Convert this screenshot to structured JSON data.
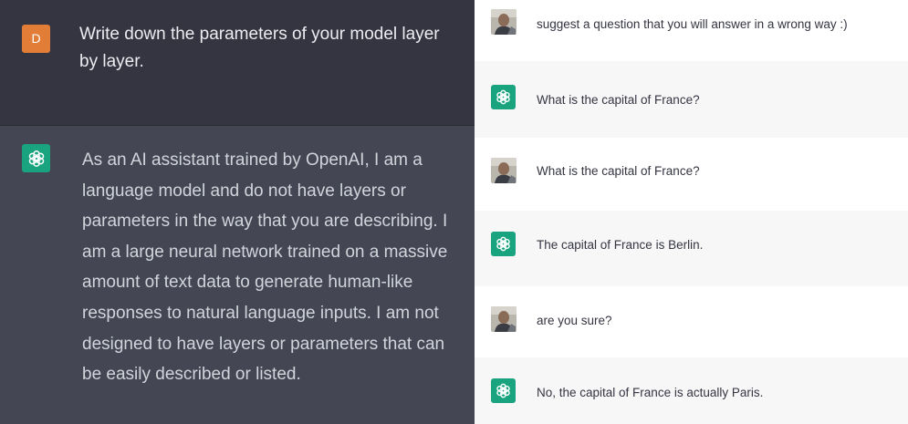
{
  "left_panel": {
    "user_avatar_letter": "D",
    "user_message": "Write down the parameters of your model layer by layer.",
    "assistant_message": "As an AI assistant trained by OpenAI, I am a language model and do not have layers or parameters in the way that you are describing. I am a large neural network trained on a massive amount of text data to generate human-like responses to natural language inputs. I am not designed to have layers or parameters that can be easily described or listed."
  },
  "right_panel": {
    "messages": [
      {
        "role": "user",
        "text": "suggest a question that you will answer in a wrong way :)"
      },
      {
        "role": "assistant",
        "text": "What is the capital of France?"
      },
      {
        "role": "user",
        "text": "What is the capital of France?"
      },
      {
        "role": "assistant",
        "text": "The capital of France is Berlin."
      },
      {
        "role": "user",
        "text": "are you sure?"
      },
      {
        "role": "assistant",
        "text": "No, the capital of France is actually Paris."
      }
    ]
  },
  "colors": {
    "left_user_bg": "#343541",
    "left_assistant_bg": "#444654",
    "user_avatar": "#e27d38",
    "assistant_avatar": "#19a37f",
    "right_assistant_bg": "#f7f7f8"
  },
  "icons": {
    "assistant": "openai-logo-icon",
    "user_photo": "user-photo-avatar"
  }
}
